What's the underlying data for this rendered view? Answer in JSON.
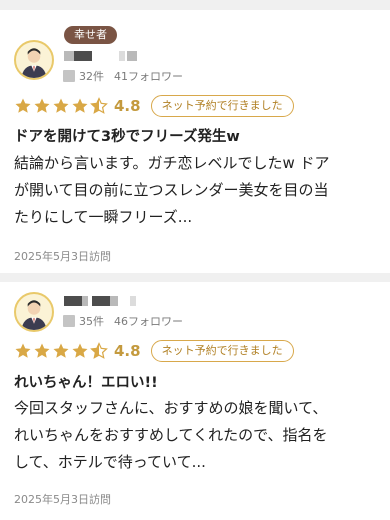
{
  "reviews": [
    {
      "badge": "幸せ者",
      "reviews_count": "32件",
      "followers": "41フォロワー",
      "rating": "4.8",
      "rating_value": 4.5,
      "visit_type": "ネット予約で行きました",
      "title": "ドアを開けて3秒でフリーズ発生w",
      "body_lines": [
        "結論から言います。ガチ恋レベルでしたw ドア",
        "が開いて目の前に立つスレンダー美女を目の当",
        "たりにして一瞬フリーズ..."
      ],
      "visit_date": "2025年5月3日訪問"
    },
    {
      "badge": "",
      "reviews_count": "35件",
      "followers": "46フォロワー",
      "rating": "4.8",
      "rating_value": 4.5,
      "visit_type": "ネット予約で行きました",
      "title": "れいちゃん！エロい!!",
      "body_lines": [
        "今回スタッフさんに、おすすめの娘を聞いて、",
        "れいちゃんをおすすめしてくれたので、指名を",
        "して、ホテルで待っていて..."
      ],
      "visit_date": "2025年5月3日訪問"
    }
  ],
  "icons": {
    "avatar": "user-avatar-icon",
    "reviews_count": "document-icon",
    "star": "star-icon"
  },
  "colors": {
    "accent": "#d8a84b",
    "star": "#d9a846",
    "badge": "#7a5444"
  }
}
